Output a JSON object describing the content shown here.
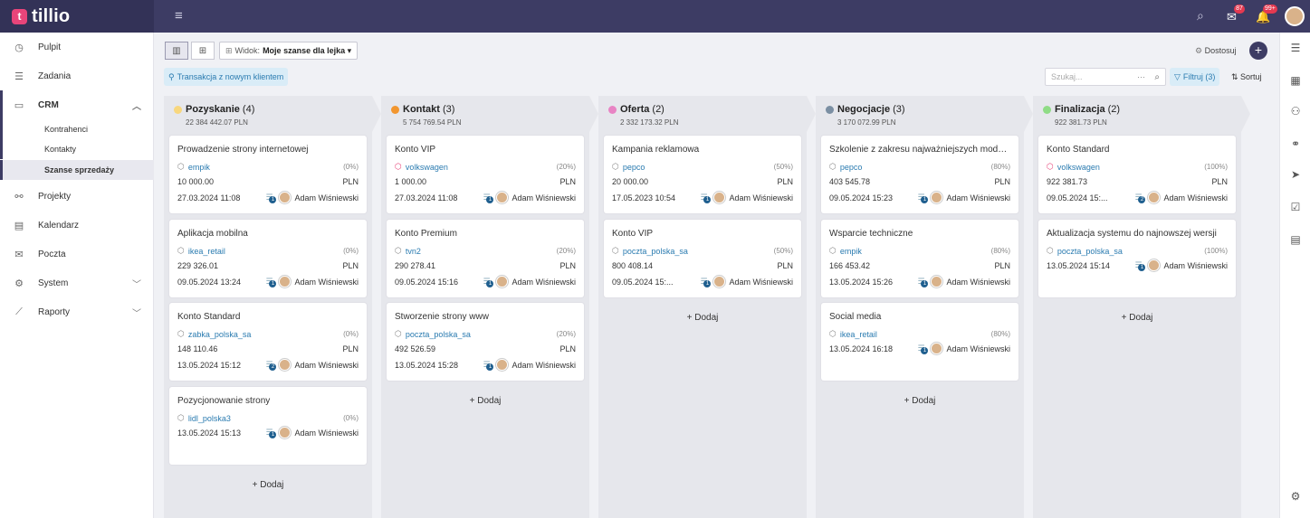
{
  "app": {
    "logo_mark": "t",
    "logo_text": "tillio"
  },
  "topbar": {
    "menu_icon": "hamburger-icon",
    "search_icon": "search-icon",
    "mail_badge": "87",
    "bell_badge": "99+"
  },
  "sidebar": {
    "items": [
      {
        "label": "Pulpit",
        "icon": "dashboard-icon",
        "glyph": "◷"
      },
      {
        "label": "Zadania",
        "icon": "tasks-icon",
        "glyph": "☰"
      },
      {
        "label": "CRM",
        "icon": "crm-icon",
        "glyph": "▭"
      },
      {
        "label": "Projekty",
        "icon": "projects-icon",
        "glyph": "⚯"
      },
      {
        "label": "Kalendarz",
        "icon": "calendar-icon",
        "glyph": "▤"
      },
      {
        "label": "Poczta",
        "icon": "mail-icon",
        "glyph": "✉"
      },
      {
        "label": "System",
        "icon": "gear-icon",
        "glyph": "⚙"
      },
      {
        "label": "Raporty",
        "icon": "chart-icon",
        "glyph": "⟋"
      }
    ],
    "crm_sub": [
      "Kontrahenci",
      "Kontakty",
      "Szanse sprzedaży"
    ]
  },
  "toolbar": {
    "widok_label": "Widok:",
    "widok_value": "Moje szanse dla lejka ▾",
    "dostosuj": "Dostosuj",
    "new_client": "Transakcja z nowym klientem",
    "search_placeholder": "Szukaj...",
    "search_dots": "···",
    "filtruj": "Filtruj (3)",
    "sortuj": "Sortuj"
  },
  "add_label": "+ Dodaj",
  "columns": [
    {
      "name": "Pozyskanie",
      "count": "(4)",
      "sum": "22 384 442.07 PLN",
      "color": "#f8d77e",
      "cards": [
        {
          "title": "Prowadzenie strony internetowej",
          "tag": "empik",
          "tag_red": false,
          "pct": "(0%)",
          "value": "10 000.00",
          "cur": "PLN",
          "date": "27.03.2024 11:08",
          "n": "1",
          "user": "Adam Wiśniewski"
        },
        {
          "title": "Aplikacja mobilna",
          "tag": "ikea_retail",
          "tag_red": false,
          "pct": "(0%)",
          "value": "229 326.01",
          "cur": "PLN",
          "date": "09.05.2024 13:24",
          "n": "1",
          "user": "Adam Wiśniewski"
        },
        {
          "title": "Konto Standard",
          "tag": "zabka_polska_sa",
          "tag_red": false,
          "pct": "(0%)",
          "value": "148 110.46",
          "cur": "PLN",
          "date": "13.05.2024 15:12",
          "n": "2",
          "user": "Adam Wiśniewski"
        },
        {
          "title": "Pozycjonowanie strony",
          "tag": "lidl_polska3",
          "tag_red": false,
          "pct": "(0%)",
          "value": "",
          "cur": "",
          "date": "13.05.2024 15:13",
          "n": "1",
          "user": "Adam Wiśniewski"
        }
      ]
    },
    {
      "name": "Kontakt",
      "count": "(3)",
      "sum": "5 754 769.54 PLN",
      "color": "#f2962f",
      "cards": [
        {
          "title": "Konto VIP",
          "tag": "volkswagen",
          "tag_red": true,
          "pct": "(20%)",
          "value": "1 000.00",
          "cur": "PLN",
          "date": "27.03.2024 11:08",
          "n": "1",
          "user": "Adam Wiśniewski"
        },
        {
          "title": "Konto Premium",
          "tag": "tvn2",
          "tag_red": false,
          "pct": "(20%)",
          "value": "290 278.41",
          "cur": "PLN",
          "date": "09.05.2024 15:16",
          "n": "1",
          "user": "Adam Wiśniewski"
        },
        {
          "title": "Stworzenie strony www",
          "tag": "poczta_polska_sa",
          "tag_red": false,
          "pct": "(20%)",
          "value": "492 526.59",
          "cur": "PLN",
          "date": "13.05.2024 15:28",
          "n": "1",
          "user": "Adam Wiśniewski"
        }
      ]
    },
    {
      "name": "Oferta",
      "count": "(2)",
      "sum": "2 332 173.32 PLN",
      "color": "#e884c4",
      "cards": [
        {
          "title": "Kampania reklamowa",
          "tag": "pepco",
          "tag_red": false,
          "pct": "(50%)",
          "value": "20 000.00",
          "cur": "PLN",
          "date": "17.05.2023 10:54",
          "n": "1",
          "user": "Adam Wiśniewski"
        },
        {
          "title": "Konto VIP",
          "tag": "poczta_polska_sa",
          "tag_red": false,
          "pct": "(50%)",
          "value": "800 408.14",
          "cur": "PLN",
          "date": "09.05.2024 15:...",
          "n": "1",
          "user": "Adam Wiśniewski"
        }
      ]
    },
    {
      "name": "Negocjacje",
      "count": "(3)",
      "sum": "3 170 072.99 PLN",
      "color": "#7b8fa3",
      "cards": [
        {
          "title": "Szkolenie z zakresu najważniejszych moduł...",
          "tag": "pepco",
          "tag_red": false,
          "pct": "(80%)",
          "value": "403 545.78",
          "cur": "PLN",
          "date": "09.05.2024 15:23",
          "n": "1",
          "user": "Adam Wiśniewski"
        },
        {
          "title": "Wsparcie techniczne",
          "tag": "empik",
          "tag_red": false,
          "pct": "(80%)",
          "value": "166 453.42",
          "cur": "PLN",
          "date": "13.05.2024 15:26",
          "n": "1",
          "user": "Adam Wiśniewski"
        },
        {
          "title": "Social media",
          "tag": "ikea_retail",
          "tag_red": false,
          "pct": "(80%)",
          "value": "",
          "cur": "",
          "date": "13.05.2024 16:18",
          "n": "1",
          "user": "Adam Wiśniewski"
        }
      ]
    },
    {
      "name": "Finalizacja",
      "count": "(2)",
      "sum": "922 381.73 PLN",
      "color": "#8fdc86",
      "cards": [
        {
          "title": "Konto Standard",
          "tag": "volkswagen",
          "tag_red": true,
          "pct": "(100%)",
          "value": "922 381.73",
          "cur": "PLN",
          "date": "09.05.2024 15:...",
          "n": "2",
          "user": "Adam Wiśniewski"
        },
        {
          "title": "Aktualizacja systemu do najnowszej wersji",
          "tag": "poczta_polska_sa",
          "tag_red": false,
          "pct": "(100%)",
          "value": "",
          "cur": "",
          "date": "13.05.2024 15:14",
          "n": "1",
          "user": "Adam Wiśniewski"
        }
      ]
    }
  ]
}
